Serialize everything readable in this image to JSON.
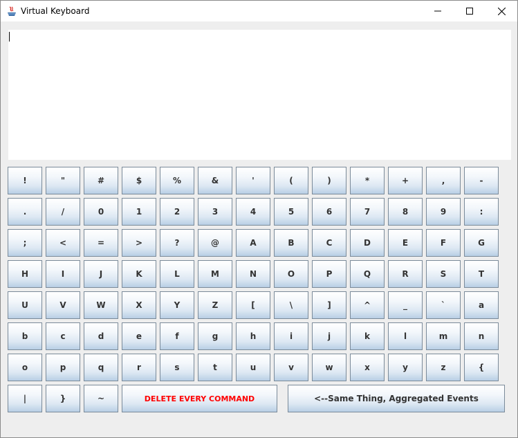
{
  "window": {
    "title": "Virtual Keyboard"
  },
  "text_area": {
    "value": ""
  },
  "keyboard": {
    "keys": [
      "!",
      "\"",
      "#",
      "$",
      "%",
      "&",
      "'",
      "(",
      ")",
      "*",
      "+",
      ",",
      "-",
      ".",
      "/",
      "0",
      "1",
      "2",
      "3",
      "4",
      "5",
      "6",
      "7",
      "8",
      "9",
      ":",
      ";",
      "<",
      "=",
      ">",
      "?",
      "@",
      "A",
      "B",
      "C",
      "D",
      "E",
      "F",
      "G",
      "H",
      "I",
      "J",
      "K",
      "L",
      "M",
      "N",
      "O",
      "P",
      "Q",
      "R",
      "S",
      "T",
      "U",
      "V",
      "W",
      "X",
      "Y",
      "Z",
      "[",
      "\\",
      "]",
      "^",
      "_",
      "`",
      "a",
      "b",
      "c",
      "d",
      "e",
      "f",
      "g",
      "h",
      "i",
      "j",
      "k",
      "l",
      "m",
      "n",
      "o",
      "p",
      "q",
      "r",
      "s",
      "t",
      "u",
      "v",
      "w",
      "x",
      "y",
      "z",
      "{",
      "|",
      "}",
      "~"
    ],
    "delete_label": "DELETE EVERY COMMAND",
    "aggregate_label": "<--Same Thing, Aggregated Events"
  },
  "colors": {
    "delete_text": "#ff0000",
    "button_text": "#333333"
  }
}
